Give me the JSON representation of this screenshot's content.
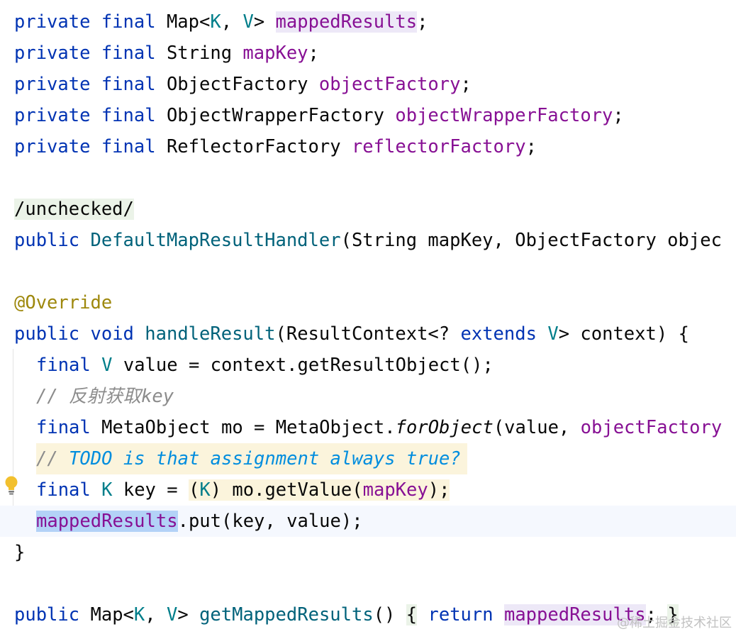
{
  "code": {
    "l1": {
      "a": "private",
      "b": "final",
      "c": "Map<",
      "d": "K",
      "e": ", ",
      "f": "V",
      "g": "> ",
      "h": "mappedResults",
      "i": ";"
    },
    "l2": {
      "a": "private",
      "b": "final",
      "c": "String ",
      "d": "mapKey",
      "e": ";"
    },
    "l3": {
      "a": "private",
      "b": "final",
      "c": "ObjectFactory ",
      "d": "objectFactory",
      "e": ";"
    },
    "l4": {
      "a": "private",
      "b": "final",
      "c": "ObjectWrapperFactory ",
      "d": "objectWrapperFactory",
      "e": ";"
    },
    "l5": {
      "a": "private",
      "b": "final",
      "c": "ReflectorFactory ",
      "d": "reflectorFactory",
      "e": ";"
    },
    "l6": {
      "a": "/unchecked/"
    },
    "l7": {
      "a": "public",
      "b": "DefaultMapResultHandler",
      "c": "(String mapKey, ObjectFactory objec"
    },
    "l8": {
      "a": "@Override"
    },
    "l9": {
      "a": "public",
      "b": "void",
      "c": "handleResult",
      "d": "(ResultContext<? ",
      "e": "extends",
      "f": "V",
      "g": "> context) {"
    },
    "l10": {
      "a": "final",
      "b": "V",
      "c": "value = context.getResultObject();"
    },
    "l11": {
      "a": "// 反射获取key"
    },
    "l12": {
      "a": "final",
      "b": "MetaObject mo = MetaObject.",
      "c": "forObject",
      "d": "(value, ",
      "e": "objectFactory"
    },
    "l13": {
      "a": "// ",
      "b": "TODO is that assignment always true?"
    },
    "l14": {
      "a": "final",
      "b": "K",
      "c": "key = ",
      "d": "(",
      "e": "K",
      "f": ") mo.getValue(",
      "g": "mapKey",
      "h": ");"
    },
    "l15": {
      "a": "mappedResults",
      "b": ".put(key, value);"
    },
    "l16": {
      "a": "}"
    },
    "l17": {
      "a": "public",
      "b": "Map<",
      "c": "K",
      "d": ", ",
      "e": "V",
      "f": "> ",
      "g": "getMappedResults",
      "h": "() ",
      "i": "{",
      "j": "return",
      "k": "mappedResults",
      "l": ";",
      "m": "}"
    }
  },
  "watermark": "@稀土掘金技术社区",
  "colors": {
    "keyword": "#0033b3",
    "type_param": "#007e8a",
    "field": "#871094",
    "method_decl": "#00627a",
    "comment": "#8c8c8c",
    "todo": "#008dde",
    "annotation": "#9e880d",
    "selection": "#b3d2f7",
    "caret_line": "#f5f8fe"
  },
  "icons": {
    "gutter": "intention-bulb-icon"
  }
}
